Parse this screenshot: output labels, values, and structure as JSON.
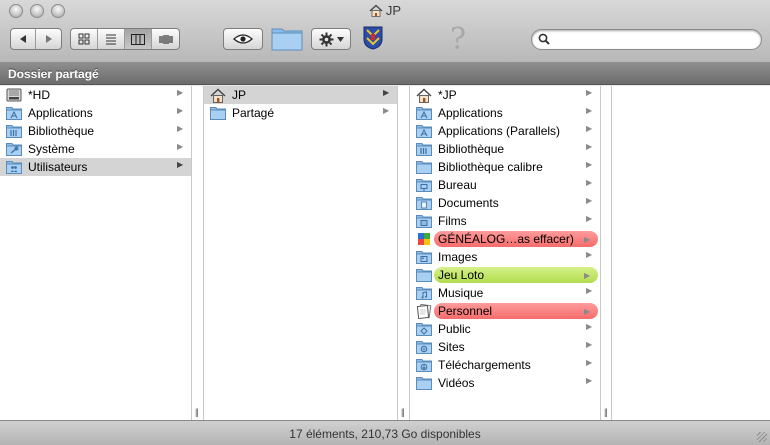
{
  "window": {
    "title": "JP"
  },
  "toolbar": {
    "back": "◀",
    "forward": "▶",
    "search_placeholder": "",
    "help_glyph": "?"
  },
  "path": {
    "title": "Dossier partagé"
  },
  "columns": {
    "c1": [
      {
        "label": "*HD",
        "icon": "hard-disk-icon"
      },
      {
        "label": "Applications",
        "icon": "applications-folder-icon"
      },
      {
        "label": "Bibliothèque",
        "icon": "library-folder-icon"
      },
      {
        "label": "Système",
        "icon": "system-folder-icon"
      },
      {
        "label": "Utilisateurs",
        "icon": "users-folder-icon",
        "selected": true
      }
    ],
    "c2": [
      {
        "label": "JP",
        "icon": "home-icon",
        "selected": true
      },
      {
        "label": "Partagé",
        "icon": "folder-icon"
      }
    ],
    "c3": [
      {
        "label": "*JP",
        "icon": "home-icon"
      },
      {
        "label": "Applications",
        "icon": "applications-folder-icon"
      },
      {
        "label": "Applications (Parallels)",
        "icon": "applications-folder-icon"
      },
      {
        "label": "Bibliothèque",
        "icon": "library-folder-icon"
      },
      {
        "label": "Bibliothèque calibre",
        "icon": "folder-icon"
      },
      {
        "label": "Bureau",
        "icon": "desktop-folder-icon"
      },
      {
        "label": "Documents",
        "icon": "documents-folder-icon"
      },
      {
        "label": "Films",
        "icon": "movies-folder-icon"
      },
      {
        "label": "GÉNÉALOG…as effacer)",
        "icon": "genealogy-app-icon",
        "tag": "red"
      },
      {
        "label": "Images",
        "icon": "pictures-folder-icon"
      },
      {
        "label": "Jeu Loto",
        "icon": "folder-icon",
        "tag": "green"
      },
      {
        "label": "Musique",
        "icon": "music-folder-icon"
      },
      {
        "label": "Personnel",
        "icon": "document-stack-icon",
        "tag": "red"
      },
      {
        "label": "Public",
        "icon": "public-folder-icon"
      },
      {
        "label": "Sites",
        "icon": "sites-folder-icon"
      },
      {
        "label": "Téléchargements",
        "icon": "downloads-folder-icon"
      },
      {
        "label": "Vidéos",
        "icon": "folder-icon"
      }
    ]
  },
  "status": {
    "text": "17 éléments, 210,73 Go disponibles"
  },
  "colors": {
    "tag_red": "#f56b6b",
    "tag_green": "#b1dc4d",
    "folder_blue": "#7fb2e3",
    "path_bar": "#7a7a7a"
  }
}
